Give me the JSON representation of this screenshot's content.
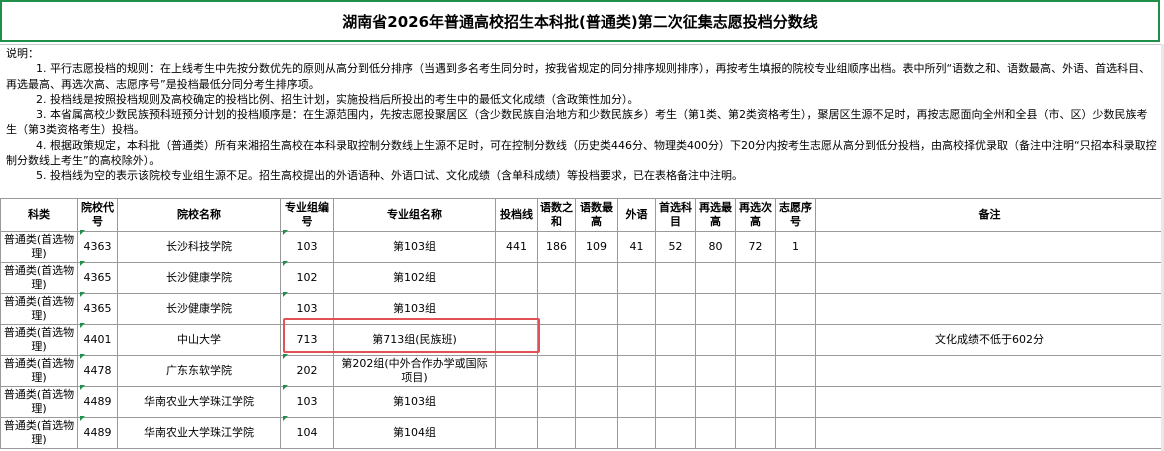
{
  "title": "湖南省2026年普通高校招生本科批(普通类)第二次征集志愿投档分数线",
  "notes": {
    "heading": "说明：",
    "items": [
      "1. 平行志愿投档的规则：在上线考生中先按分数优先的原则从高分到低分排序（当遇到多名考生同分时，按我省规定的同分排序规则排序），再按考生填报的院校专业组顺序出档。表中所列“语数之和、语数最高、外语、首选科目、再选最高、再选次高、志愿序号”是投档最低分同分考生排序项。",
      "2. 投档线是按照投档规则及高校确定的投档比例、招生计划，实施投档后所投出的考生中的最低文化成绩（含政策性加分）。",
      "3. 本省属高校少数民族预科班预分计划的投档顺序是：在生源范围内，先按志愿投聚居区（含少数民族自治地方和少数民族乡）考生（第1类、第2类资格考生），聚居区生源不足时，再按志愿面向全州和全县（市、区）少数民族考生（第3类资格考生）投档。",
      "4. 根据政策规定，本科批（普通类）所有来湘招生高校在本科录取控制分数线上生源不足时，可在控制分数线（历史类446分、物理类400分）下20分内按考生志愿从高分到低分投档，由高校择优录取（备注中注明“只招本科录取控制分数线上考生”的高校除外）。",
      "5. 投档线为空的表示该院校专业组生源不足。招生高校提出的外语语种、外语口试、文化成绩（含单科成绩）等投档要求，已在表格备注中注明。"
    ]
  },
  "table": {
    "headers": [
      "科类",
      "院校代号",
      "院校名称",
      "专业组编号",
      "专业组名称",
      "投档线",
      "语数之和",
      "语数最高",
      "外语",
      "首选科目",
      "再选最高",
      "再选次高",
      "志愿序号",
      "备注"
    ],
    "rows": [
      [
        "普通类(首选物理)",
        "4363",
        "长沙科技学院",
        "103",
        "第103组",
        "441",
        "186",
        "109",
        "41",
        "52",
        "80",
        "72",
        "1",
        ""
      ],
      [
        "普通类(首选物理)",
        "4365",
        "长沙健康学院",
        "102",
        "第102组",
        "",
        "",
        "",
        "",
        "",
        "",
        "",
        "",
        ""
      ],
      [
        "普通类(首选物理)",
        "4365",
        "长沙健康学院",
        "103",
        "第103组",
        "",
        "",
        "",
        "",
        "",
        "",
        "",
        "",
        ""
      ],
      [
        "普通类(首选物理)",
        "4401",
        "中山大学",
        "713",
        "第713组(民族班)",
        "",
        "",
        "",
        "",
        "",
        "",
        "",
        "",
        "文化成绩不低于602分"
      ],
      [
        "普通类(首选物理)",
        "4478",
        "广东东软学院",
        "202",
        "第202组(中外合作办学或国际项目)",
        "",
        "",
        "",
        "",
        "",
        "",
        "",
        "",
        ""
      ],
      [
        "普通类(首选物理)",
        "4489",
        "华南农业大学珠江学院",
        "103",
        "第103组",
        "",
        "",
        "",
        "",
        "",
        "",
        "",
        "",
        ""
      ],
      [
        "普通类(首选物理)",
        "4489",
        "华南农业大学珠江学院",
        "104",
        "第104组",
        "",
        "",
        "",
        "",
        "",
        "",
        "",
        "",
        ""
      ]
    ]
  },
  "colors": {
    "accent": "#1f8f4a",
    "highlight": "#e05256",
    "grid": "#9a9a9a"
  }
}
